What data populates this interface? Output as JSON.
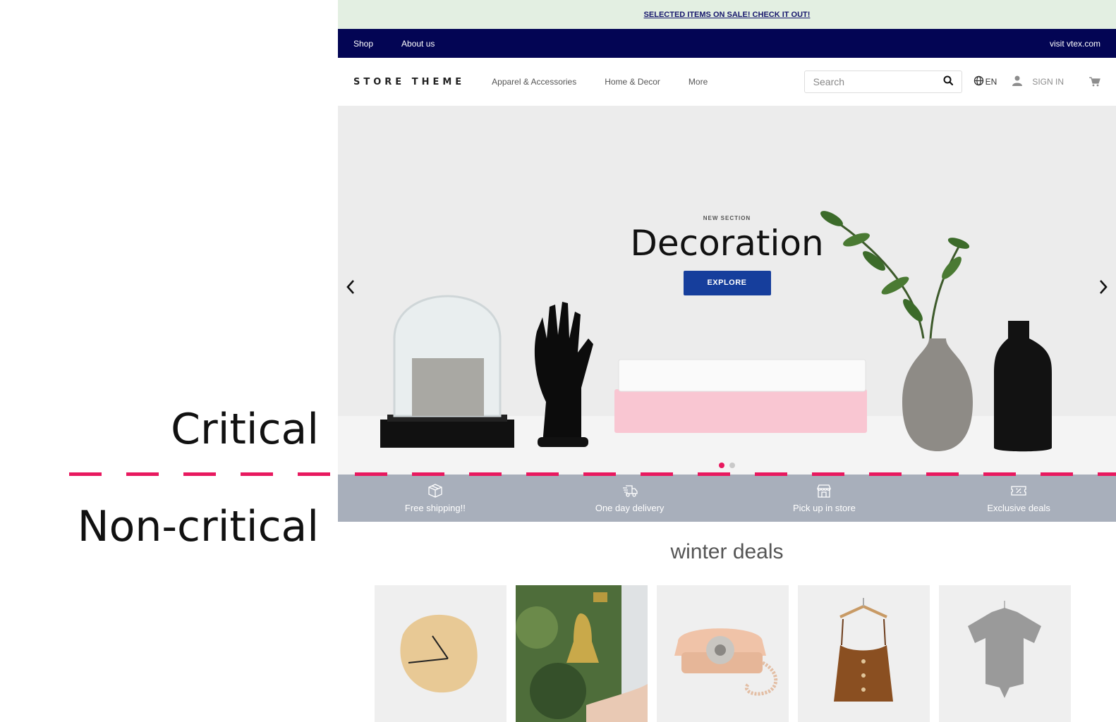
{
  "annotations": {
    "critical": "Critical",
    "non_critical": "Non-critical",
    "fold_line_color": "#e8195f"
  },
  "promo_bar": {
    "text": "SELECTED ITEMS ON SALE! CHECK IT OUT!"
  },
  "top_nav": {
    "items": [
      "Shop",
      "About us"
    ],
    "right_link": "visit vtex.com"
  },
  "header": {
    "logo": "STORE THEME",
    "menu": [
      "Apparel & Accessories",
      "Home & Decor",
      "More"
    ],
    "search_placeholder": "Search",
    "language": "EN",
    "sign_in": "SIGN IN"
  },
  "hero": {
    "eyebrow": "NEW SECTION",
    "title": "Decoration",
    "cta": "EXPLORE",
    "slide_count": 2,
    "active_slide": 1
  },
  "features": [
    {
      "label": "Free shipping!!",
      "icon": "package-icon"
    },
    {
      "label": "One day delivery",
      "icon": "delivery-truck-icon"
    },
    {
      "label": "Pick up in store",
      "icon": "store-icon"
    },
    {
      "label": "Exclusive deals",
      "icon": "ticket-icon"
    }
  ],
  "shelf": {
    "title": "winter deals",
    "products": [
      "wall-clock",
      "brass-bell",
      "rotary-telephone",
      "brown-camisole",
      "grey-tshirt"
    ]
  },
  "colors": {
    "promo_bg": "#e3efe2",
    "nav_bg": "#030554",
    "cta_bg": "#163e9c",
    "features_bg": "#a8afbb"
  }
}
